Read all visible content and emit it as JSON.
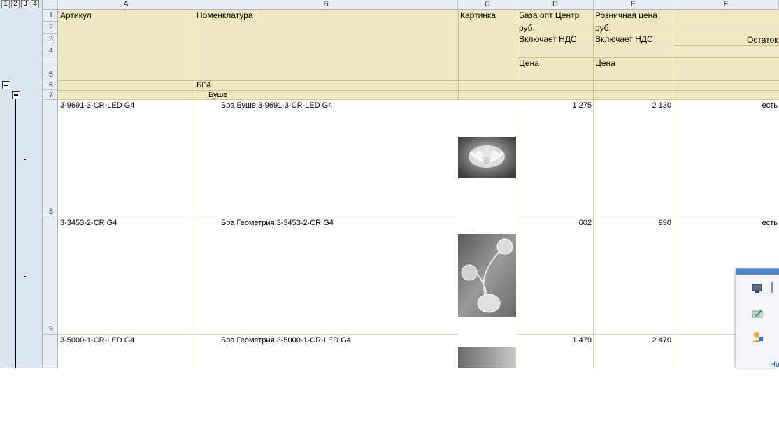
{
  "outline": {
    "levels": [
      "1",
      "2",
      "3",
      "4"
    ]
  },
  "columns": [
    {
      "id": "corner",
      "label": ""
    },
    {
      "id": "A",
      "label": "A"
    },
    {
      "id": "B",
      "label": "B"
    },
    {
      "id": "C",
      "label": "C"
    },
    {
      "id": "D",
      "label": "D"
    },
    {
      "id": "E",
      "label": "E"
    },
    {
      "id": "F",
      "label": "F"
    }
  ],
  "row_numbers": [
    "1",
    "2",
    "3",
    "4",
    "5",
    "6",
    "7",
    "8",
    "9"
  ],
  "header": {
    "articul": "Артикул",
    "nomenclature": "Номенклатура",
    "picture": "Картинка",
    "base_price": "База опт Центр",
    "retail_price": "Розничная цена",
    "currency_d": "руб.",
    "currency_e": "руб.",
    "vat_d": "Включает НДС",
    "vat_e": "Включает НДС",
    "stock": "Остаток",
    "price_d": "Цена",
    "price_e": "Цена"
  },
  "groups": {
    "level1": "БРА",
    "level2": "Буше"
  },
  "rows": [
    {
      "articul": "3-9691-3-CR-LED G4",
      "name": "Бра Буше 3-9691-3-CR-LED G4",
      "base": "1 275",
      "retail": "2 130",
      "stock": "есть"
    },
    {
      "articul": "3-3453-2-CR G4",
      "name": "Бра Геометрия 3-3453-2-CR G4",
      "base": "602",
      "retail": "990",
      "stock": "есть"
    },
    {
      "articul": "3-5000-1-CR-LED G4",
      "name": "Бра Геометрия 3-5000-1-CR-LED G4",
      "base": "1 479",
      "retail": "2 470",
      "stock": ""
    }
  ],
  "popup": {
    "link_text": "На"
  },
  "icons": {
    "monitor": "monitor-icon",
    "check": "check-icon",
    "user": "user-key-icon",
    "product_images": [
      "wall-lamp-image",
      "sconce-image",
      "lamp-image"
    ]
  }
}
